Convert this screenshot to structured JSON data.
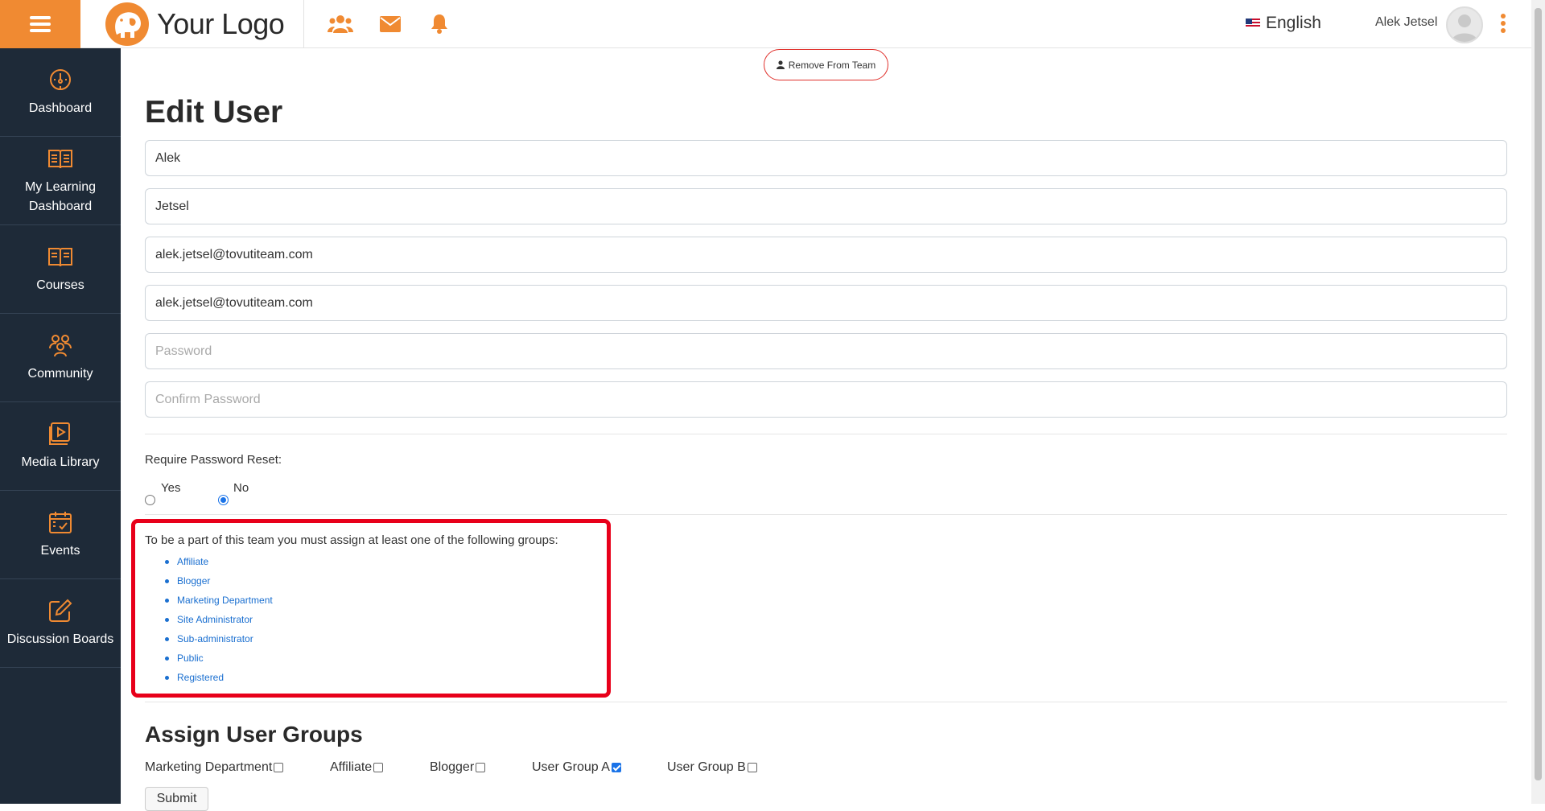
{
  "header": {
    "logo_text": "Your Logo",
    "language": "English",
    "user_name": "Alek Jetsel",
    "accent_color": "#f08a32"
  },
  "sidebar": {
    "items": [
      {
        "label": "Dashboard",
        "icon": "gauge-icon"
      },
      {
        "label": "My Learning Dashboard",
        "icon": "open-book-icon"
      },
      {
        "label": "Courses",
        "icon": "book-icon"
      },
      {
        "label": "Community",
        "icon": "community-icon"
      },
      {
        "label": "Media Library",
        "icon": "media-library-icon"
      },
      {
        "label": "Events",
        "icon": "calendar-icon"
      },
      {
        "label": "Discussion Boards",
        "icon": "edit-icon"
      }
    ]
  },
  "main": {
    "remove_button": "Remove From Team",
    "title": "Edit User",
    "fields": {
      "first_name": "Alek",
      "last_name": "Jetsel",
      "email": "alek.jetsel@tovutiteam.com",
      "email_confirm": "alek.jetsel@tovutiteam.com",
      "password_placeholder": "Password",
      "confirm_password_placeholder": "Confirm Password"
    },
    "password_reset": {
      "label": "Require Password Reset:",
      "yes": "Yes",
      "no": "No",
      "selected": "No"
    },
    "notice": {
      "text": "To be a part of this team you must assign at least one of the following groups:",
      "groups": [
        "Affiliate",
        "Blogger",
        "Marketing Department",
        "Site Administrator",
        "Sub-administrator",
        "Public",
        "Registered"
      ],
      "highlight_color": "#e8001a"
    },
    "assign": {
      "title": "Assign User Groups",
      "groups": [
        {
          "label": "Marketing Department",
          "checked": false
        },
        {
          "label": "Affiliate",
          "checked": false
        },
        {
          "label": "Blogger",
          "checked": false
        },
        {
          "label": "User Group A",
          "checked": true
        },
        {
          "label": "User Group B",
          "checked": false
        }
      ],
      "submit": "Submit"
    }
  }
}
